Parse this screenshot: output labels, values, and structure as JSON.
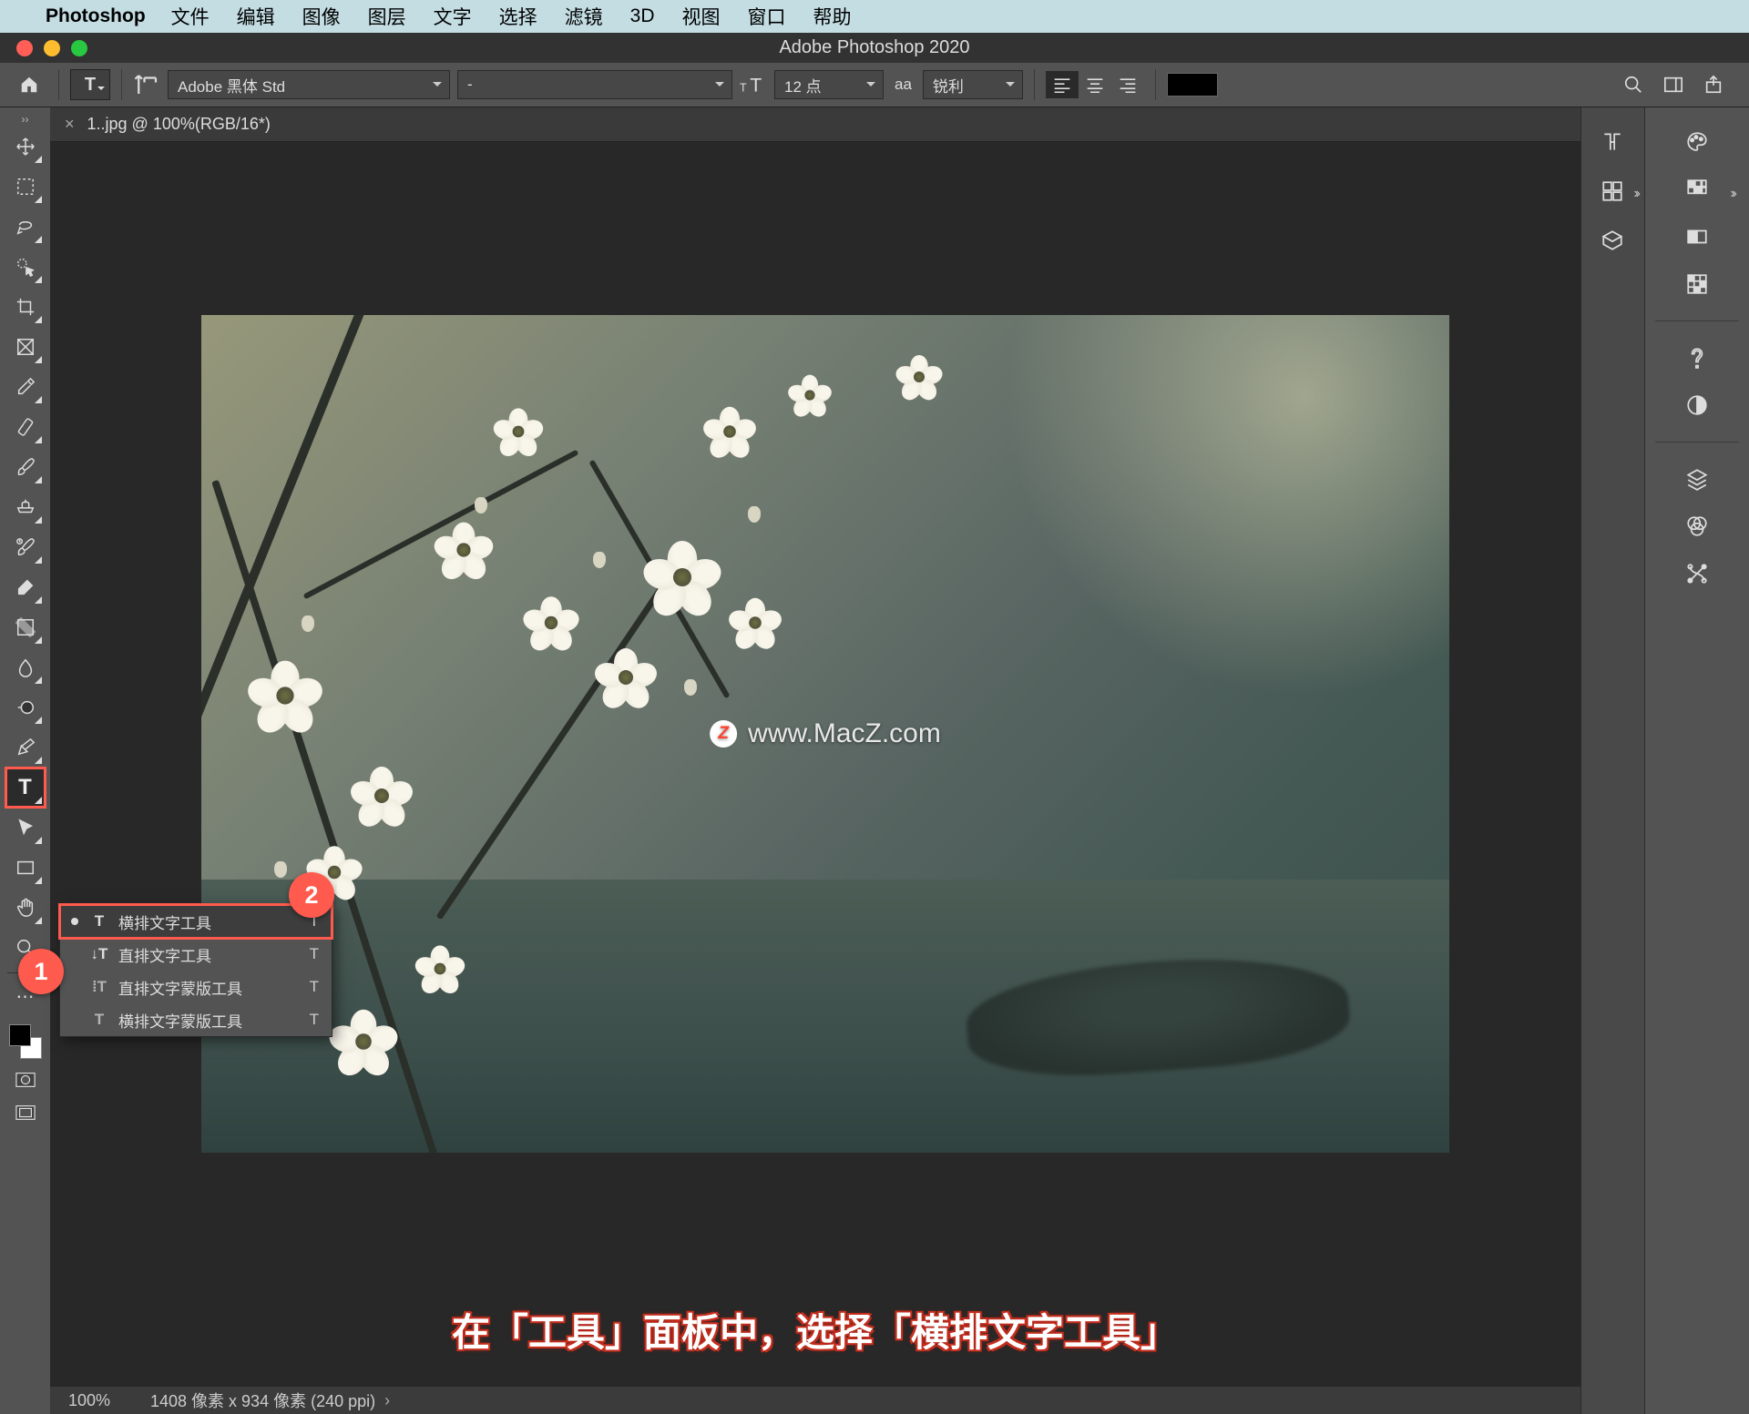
{
  "mac_menu": {
    "app_name": "Photoshop",
    "items": [
      "文件",
      "编辑",
      "图像",
      "图层",
      "文字",
      "选择",
      "滤镜",
      "3D",
      "视图",
      "窗口",
      "帮助"
    ]
  },
  "window_title": "Adobe Photoshop 2020",
  "options_bar": {
    "font_family": "Adobe 黑体 Std",
    "font_style": "-",
    "font_size": "12 点",
    "aa_mode": "锐利",
    "aa_label": "aa"
  },
  "document": {
    "tab_label": "1..jpg @ 100%(RGB/16*)"
  },
  "watermark": {
    "badge": "Z",
    "text": "www.MacZ.com"
  },
  "tool_flyout": {
    "items": [
      {
        "label": "横排文字工具",
        "shortcut": "T",
        "current": true
      },
      {
        "label": "直排文字工具",
        "shortcut": "T",
        "current": false
      },
      {
        "label": "直排文字蒙版工具",
        "shortcut": "T",
        "current": false
      },
      {
        "label": "横排文字蒙版工具",
        "shortcut": "T",
        "current": false
      }
    ]
  },
  "annotations": {
    "badge1": "1",
    "badge2": "2",
    "caption": "在「工具」面板中，选择「横排文字工具」"
  },
  "status": {
    "zoom": "100%",
    "doc_info": "1408 像素 x 934 像素 (240 ppi)"
  }
}
